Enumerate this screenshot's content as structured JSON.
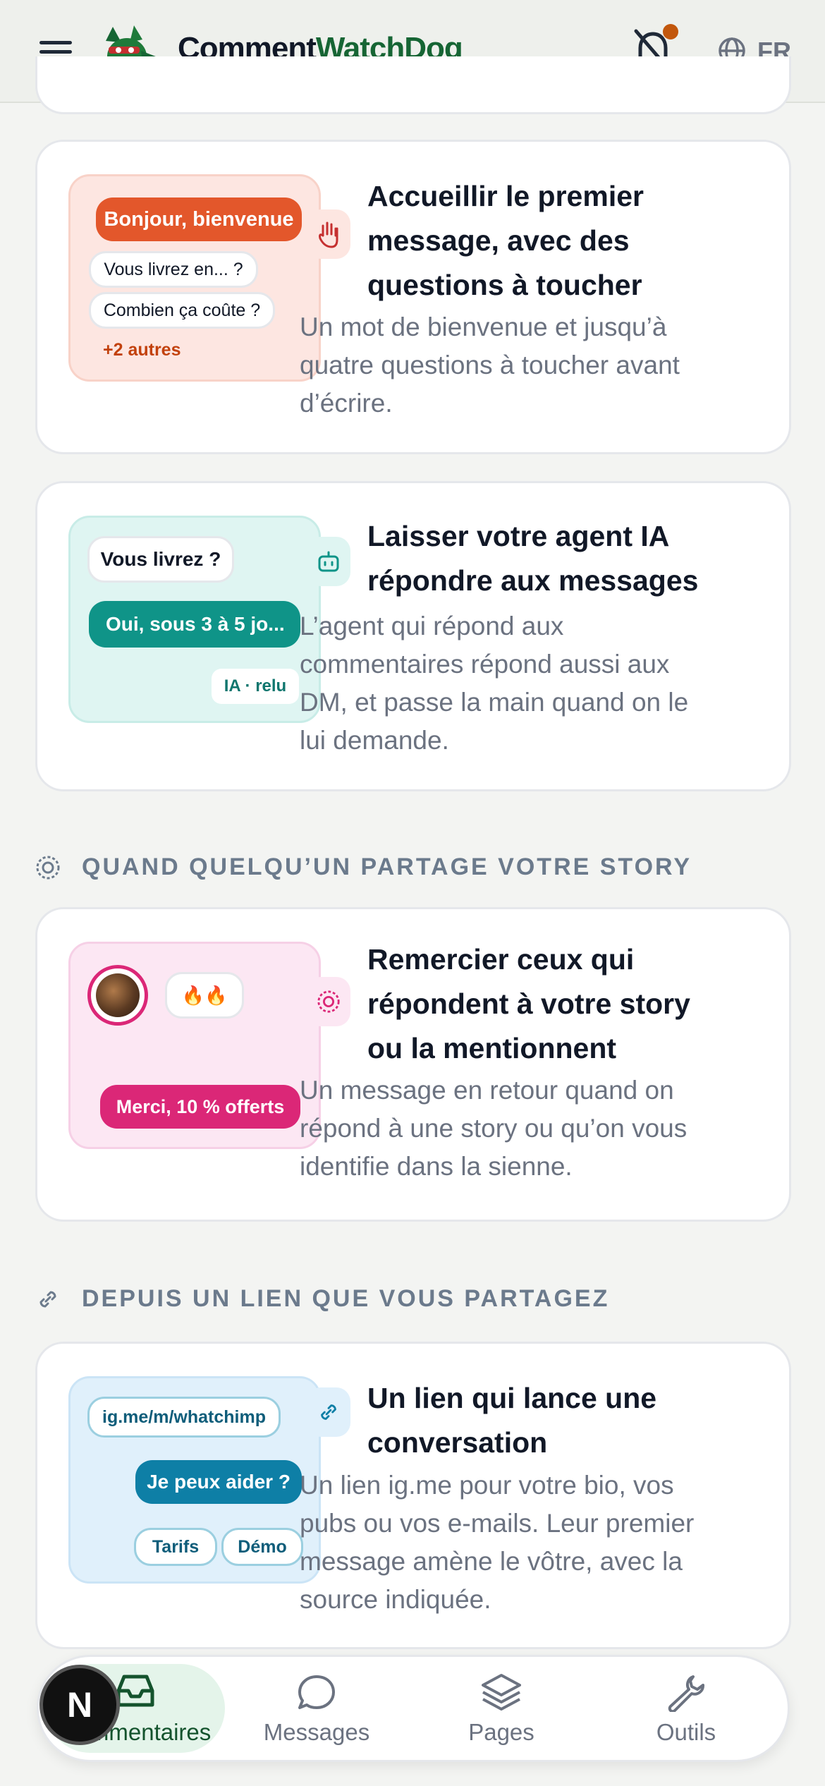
{
  "header": {
    "brand_part1": "Comment",
    "brand_part2": "WatchDog",
    "language": "FR",
    "icons": [
      "menu-icon",
      "logo-dog-icon",
      "bell-off-icon",
      "globe-icon"
    ],
    "accent_color": "#166534",
    "notification_dot_color": "#c2570c"
  },
  "cards": [
    {
      "title_lines": [
        "Accueillir le premier",
        "message, avec des",
        "questions à toucher"
      ],
      "desc_lines": [
        "Un mot de bienvenue et jusqu’à",
        "quatre questions à toucher avant",
        "d’écrire."
      ],
      "illus": {
        "greeting": "Bonjour, bienvenue",
        "q1": "Vous livrez en... ?",
        "q2": "Combien ça coûte ?",
        "more": "+2 autres"
      },
      "icon": "hand-icon"
    },
    {
      "title_lines": [
        "Laisser votre agent IA",
        "répondre aux messages"
      ],
      "desc_lines": [
        "L’agent qui répond aux",
        "commentaires répond aussi aux",
        "DM, et passe la main quand on le",
        "lui demande."
      ],
      "illus": {
        "question": "Vous livrez ?",
        "answer": "Oui, sous 3 à 5 jo...",
        "tag": "IA · relu"
      },
      "icon": "bot-icon"
    },
    {
      "title_lines": [
        "Remercier ceux qui",
        "répondent à votre story",
        "ou la mentionnent"
      ],
      "desc_lines": [
        "Un message en retour quand on",
        "répond à une story ou qu’on vous",
        "identifie dans la sienne."
      ],
      "illus": {
        "reaction": "🔥🔥",
        "reply": "Merci, 10 % offerts"
      },
      "icon": "story-icon"
    },
    {
      "title_lines": [
        "Un lien qui lance une",
        "conversation"
      ],
      "desc_lines": [
        "Un lien ig.me pour votre bio, vos",
        "pubs ou vos e-mails. Leur premier",
        "message amène le vôtre, avec la",
        "source indiquée."
      ],
      "illus": {
        "link": "ig.me/m/whatchimp",
        "message": "Je peux aider ?",
        "chip1": "Tarifs",
        "chip2": "Démo"
      },
      "icon": "link-icon"
    }
  ],
  "sections": {
    "story": "QUAND QUELQU’UN PARTAGE VOTRE STORY",
    "link": "DEPUIS UN LIEN QUE VOUS PARTAGEZ"
  },
  "bottom_nav": {
    "items": [
      "Commentaires",
      "Messages",
      "Pages",
      "Outils"
    ],
    "active": "Commentaires",
    "badge": "N"
  }
}
